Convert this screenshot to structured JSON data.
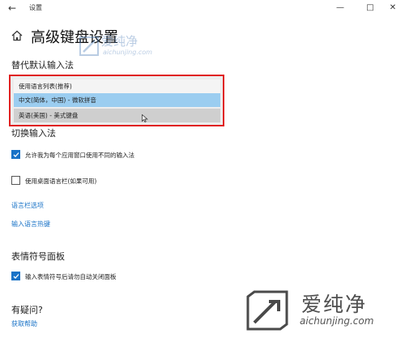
{
  "window": {
    "back_icon": "←",
    "title": "设置",
    "minimize_icon": "—",
    "maximize_icon": "□",
    "close_icon": "✕"
  },
  "page": {
    "title": "高级键盘设置"
  },
  "override_input": {
    "heading": "替代默认输入法",
    "options": [
      "使用语言列表(推荐)",
      "中文(简体，中国) - 微软拼音",
      "英语(美国) - 美式键盘"
    ],
    "highlighted_index": 1
  },
  "switch_input": {
    "heading": "切换输入法",
    "checkboxes": [
      {
        "label": "允许我为每个应用窗口使用不同的输入法",
        "checked": true
      },
      {
        "label": "使用桌面语言栏(如果可用)",
        "checked": false
      }
    ],
    "links": [
      "语言栏选项",
      "输入语言热键"
    ]
  },
  "emoji_panel": {
    "heading": "表情符号面板",
    "checkbox": {
      "label": "输入表情符号后请勿自动关闭面板",
      "checked": true
    }
  },
  "help": {
    "heading": "有疑问?",
    "link": "获取帮助"
  },
  "watermark": {
    "brand": "爱纯净",
    "url": "aichunjing.com"
  },
  "colors": {
    "accent": "#1a73c7",
    "highlight_border": "#e02020",
    "selected_option": "#9bcdf0"
  }
}
